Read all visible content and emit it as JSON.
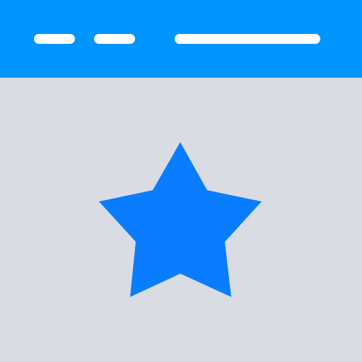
{
  "colors": {
    "titlebar": "#0095FF",
    "content_background": "#D9DCE2",
    "placeholder_bars": "#FFFFFF",
    "star": "#0A7CFF"
  },
  "icon": "browser-window-favorite-star-icon"
}
